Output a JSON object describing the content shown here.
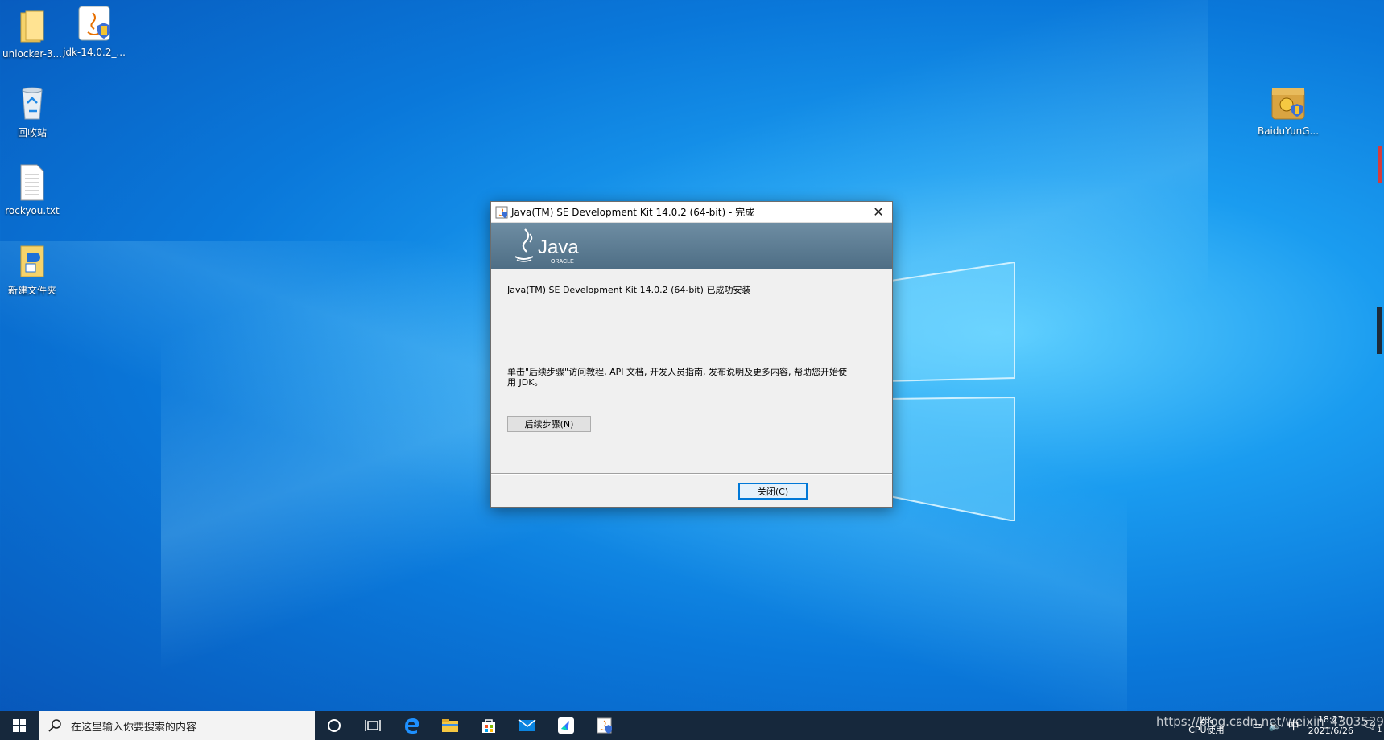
{
  "desktop": {
    "icons": [
      {
        "label": "unlocker-3...",
        "icon": "folder-icon"
      },
      {
        "label": "jdk-14.0.2_...",
        "icon": "java-installer-icon"
      },
      {
        "label": "回收站",
        "icon": "recycle-bin-icon"
      },
      {
        "label": "rockyou.txt",
        "icon": "text-file-icon"
      },
      {
        "label": "新建文件夹",
        "icon": "folder-icon"
      },
      {
        "label": "BaiduYunG...",
        "icon": "baidu-installer-icon"
      }
    ]
  },
  "dialog": {
    "title": "Java(TM) SE Development Kit 14.0.2 (64-bit) - 完成",
    "close_glyph": "✕",
    "logo_text": "Java",
    "logo_subtext": "ORACLE",
    "message_installed": "Java(TM) SE Development Kit 14.0.2 (64-bit) 已成功安装",
    "message_next": "单击\"后续步骤\"访问教程, API 文档, 开发人员指南, 发布说明及更多内容, 帮助您开始使用 JDK。",
    "next_steps_button": "后续步骤(N)",
    "close_button": "关闭(C)"
  },
  "taskbar": {
    "search_placeholder": "在这里输入你要搜索的内容",
    "cpu_percent": "2%",
    "cpu_label": "CPU使用",
    "ime": "中",
    "time": "18:27",
    "date": "2021/6/26",
    "notification_count": "1"
  },
  "watermark": "https://blog.csdn.net/weixin_43035295",
  "colors": {
    "taskbar": "#16283c",
    "accent": "#0078d7",
    "dialog_banner": "#5a7a91"
  }
}
